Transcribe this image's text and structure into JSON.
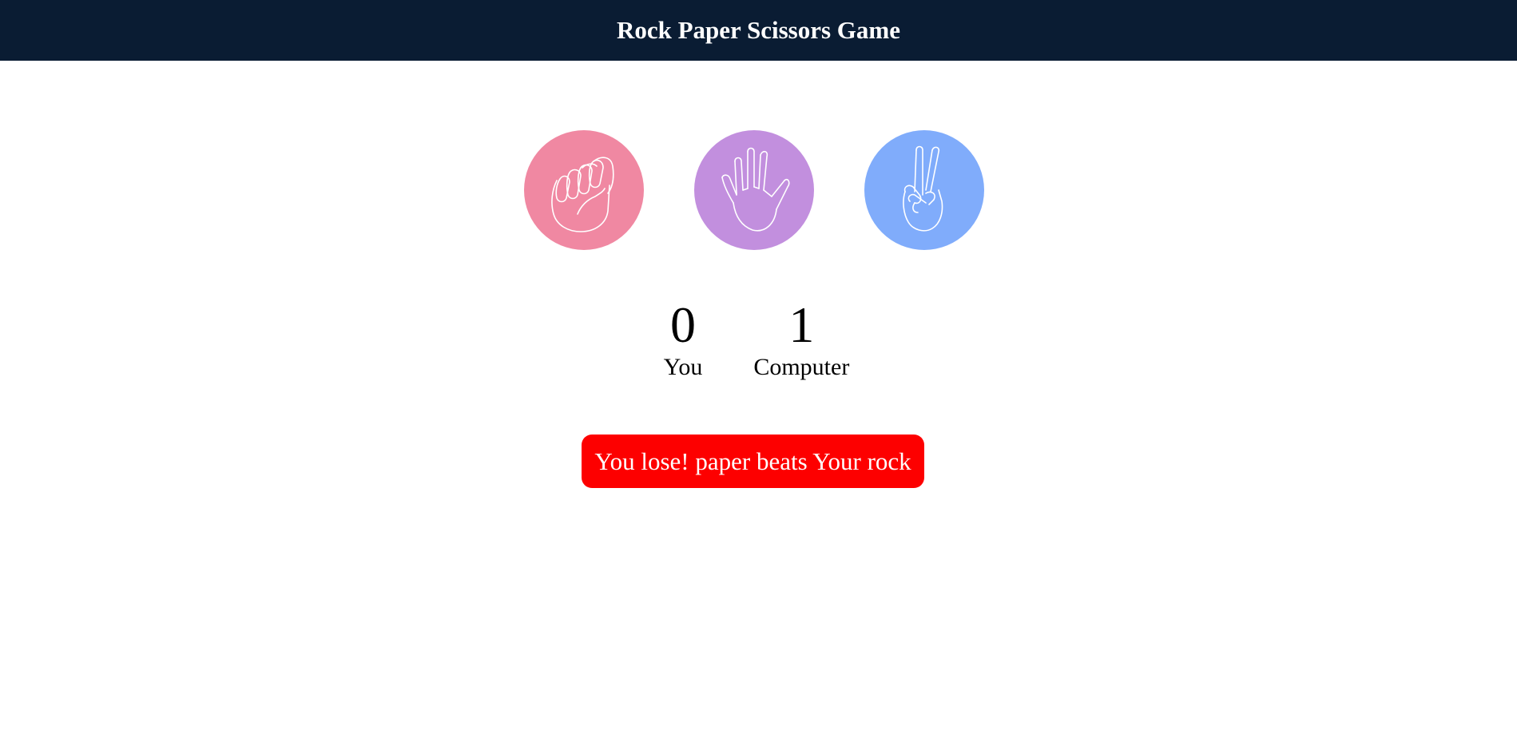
{
  "header": {
    "title": "Rock Paper Scissors Game"
  },
  "choices": [
    {
      "name": "rock",
      "icon": "fist-icon",
      "color": "#f088a2"
    },
    {
      "name": "paper",
      "icon": "open-hand-icon",
      "color": "#c28fde"
    },
    {
      "name": "scissors",
      "icon": "peace-hand-icon",
      "color": "#80acfb"
    }
  ],
  "score": {
    "user": "0",
    "user_label": "You",
    "computer": "1",
    "computer_label": "Computer"
  },
  "result": {
    "message": "You lose! paper beats Your rock"
  },
  "colors": {
    "header_bg": "#0a1c33",
    "result_bg": "#fd0000",
    "icon_stroke": "#ffffff"
  }
}
